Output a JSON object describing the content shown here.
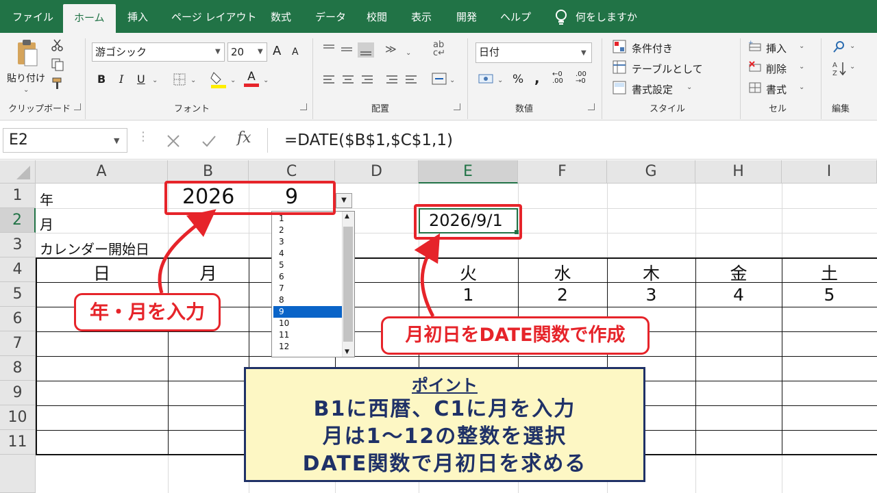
{
  "ribbon_tabs": [
    "ファイル",
    "ホーム",
    "挿入",
    "ページ レイアウト",
    "数式",
    "データ",
    "校閲",
    "表示",
    "開発",
    "ヘルプ"
  ],
  "tell_me": "何をしますか",
  "clipboard": {
    "paste": "貼り付け",
    "label": "クリップボード"
  },
  "font": {
    "name": "游ゴシック",
    "size": "20",
    "grow": "A",
    "shrink": "A",
    "bold": "B",
    "italic": "I",
    "underline": "U",
    "color_letter": "A",
    "label": "フォント"
  },
  "alignment": {
    "label": "配置"
  },
  "number": {
    "format": "日付",
    "percent": "%",
    "comma": ",",
    "label": "数値"
  },
  "styles": {
    "conditional": "条件付き",
    "table": "テーブルとして",
    "cell_styles": "書式設定",
    "label": "スタイル"
  },
  "cells": {
    "insert": "挿入",
    "delete": "削除",
    "format": "書式",
    "label": "セル"
  },
  "editing": {
    "label": "編集"
  },
  "formula_bar": {
    "name_box": "E2",
    "formula": "=DATE($B$1,$C$1,1)",
    "fx": "fx"
  },
  "columns": [
    "A",
    "B",
    "C",
    "D",
    "E",
    "F",
    "G",
    "H",
    "I"
  ],
  "rows": [
    "1",
    "2",
    "3",
    "4",
    "5",
    "6",
    "7",
    "8",
    "9",
    "10",
    "11"
  ],
  "cells_data": {
    "a1": "年",
    "a2": "月",
    "a3": "カレンダー開始日",
    "b1": "2026",
    "c1": "9",
    "e2": "2026/9/1"
  },
  "calendar_headers": {
    "sun": "日",
    "mon": "月",
    "tue": "火",
    "wed": "水",
    "thu": "木",
    "fri": "金",
    "sat": "土"
  },
  "week1": [
    "1",
    "2",
    "3",
    "4",
    "5"
  ],
  "dropdown_options": [
    "1",
    "2",
    "3",
    "4",
    "5",
    "6",
    "7",
    "8",
    "9",
    "10",
    "11",
    "12"
  ],
  "dropdown_selected": "9",
  "callouts": {
    "input": "年・月を入力",
    "date_func": "月初日をDATE関数で作成"
  },
  "point": {
    "title": "ポイント",
    "line1": "B1に西暦、C1に月を入力",
    "line2": "月は1～12の整数を選択",
    "line3": "DATE関数で月初日を求める"
  },
  "colors": {
    "excel_green": "#217346",
    "annotation_red": "#e6242a",
    "point_bg": "#fdf7c4",
    "point_border": "#1f3167",
    "selected_option": "#0a64c8"
  }
}
